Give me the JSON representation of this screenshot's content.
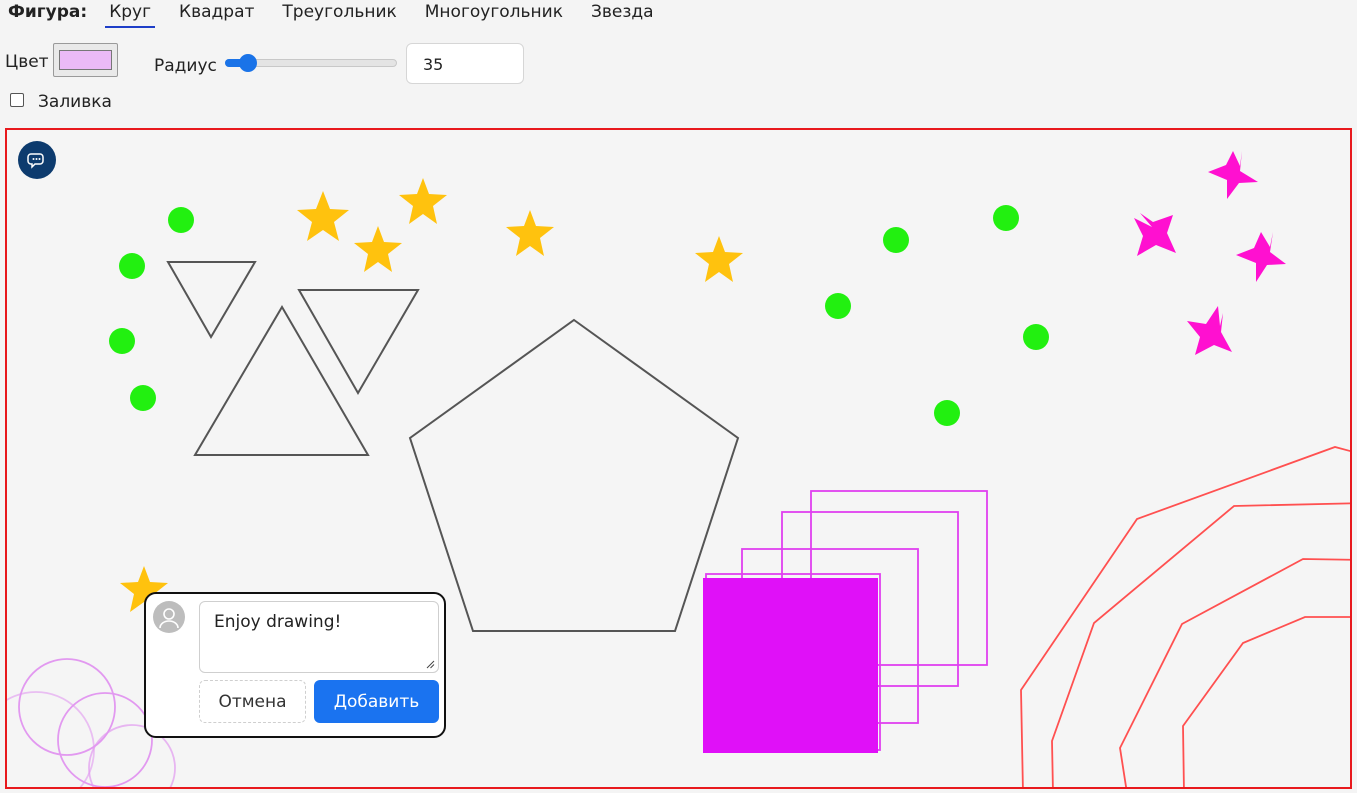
{
  "toolbar": {
    "figure_label": "Фигура:",
    "tabs": [
      {
        "label": "Круг",
        "active": true
      },
      {
        "label": "Квадрат",
        "active": false
      },
      {
        "label": "Треугольник",
        "active": false
      },
      {
        "label": "Многоугольник",
        "active": false
      },
      {
        "label": "Звезда",
        "active": false
      }
    ],
    "color_label": "Цвет",
    "color_value": "#ebbaf6",
    "radius_label": "Радиус",
    "radius_value": "35",
    "radius_slider_fraction": 0.09,
    "fill_label": "Заливка",
    "fill_checked": false
  },
  "canvas": {
    "border_color": "#e8191d",
    "icons": [
      "chat-icon"
    ]
  },
  "comment_popup": {
    "text": "Enjoy drawing!",
    "cancel_label": "Отмена",
    "add_label": "Добавить",
    "icons": [
      "user-avatar-icon",
      "resize-grip-icon"
    ]
  },
  "colors": {
    "accent": "#1a73e8",
    "circle_green": "#22f010",
    "star_yellow": "#ffc20e",
    "star_magenta": "#ff10d0",
    "square_magenta": "#e010f8",
    "polygon_red": "#ff5050"
  }
}
